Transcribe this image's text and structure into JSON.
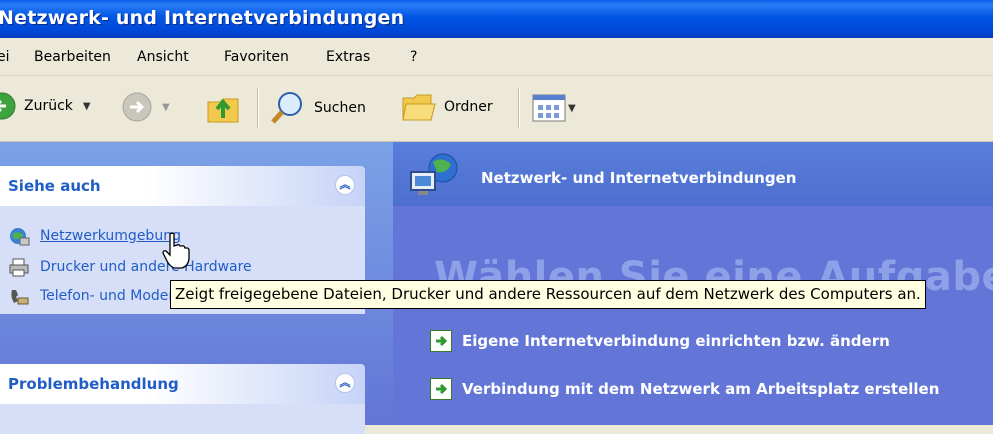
{
  "window": {
    "title": "Netzwerk- und Internetverbindungen"
  },
  "menu": {
    "items": [
      "ei",
      "Bearbeiten",
      "Ansicht",
      "Favoriten",
      "Extras",
      "?"
    ]
  },
  "toolbar": {
    "back_label": "Zurück",
    "search_label": "Suchen",
    "folders_label": "Ordner"
  },
  "sidebar": {
    "groups": [
      {
        "title": "Siehe auch",
        "items": [
          {
            "label": "Netzwerkumgebung",
            "icon": "network-places-icon"
          },
          {
            "label": "Drucker und andere Hardware",
            "icon": "printer-icon"
          },
          {
            "label": "Telefon- und Modemoptionen",
            "icon": "phone-icon"
          }
        ]
      },
      {
        "title": "Problembehandlung",
        "items": []
      }
    ]
  },
  "main": {
    "header": "Netzwerk- und Internetverbindungen",
    "big_title": "Wählen Sie eine Aufgabe",
    "tasks": [
      "Eigene Internetverbindung einrichten bzw. ändern",
      "Verbindung mit dem Netzwerk am Arbeitsplatz erstellen"
    ]
  },
  "tooltip": "Zeigt freigegebene Dateien, Drucker und andere Ressourcen auf dem Netzwerk des Computers an.",
  "colors": {
    "titlebar": "#0055e5",
    "sidebar_link": "#215dc6",
    "task_pane": "#6375d6"
  }
}
